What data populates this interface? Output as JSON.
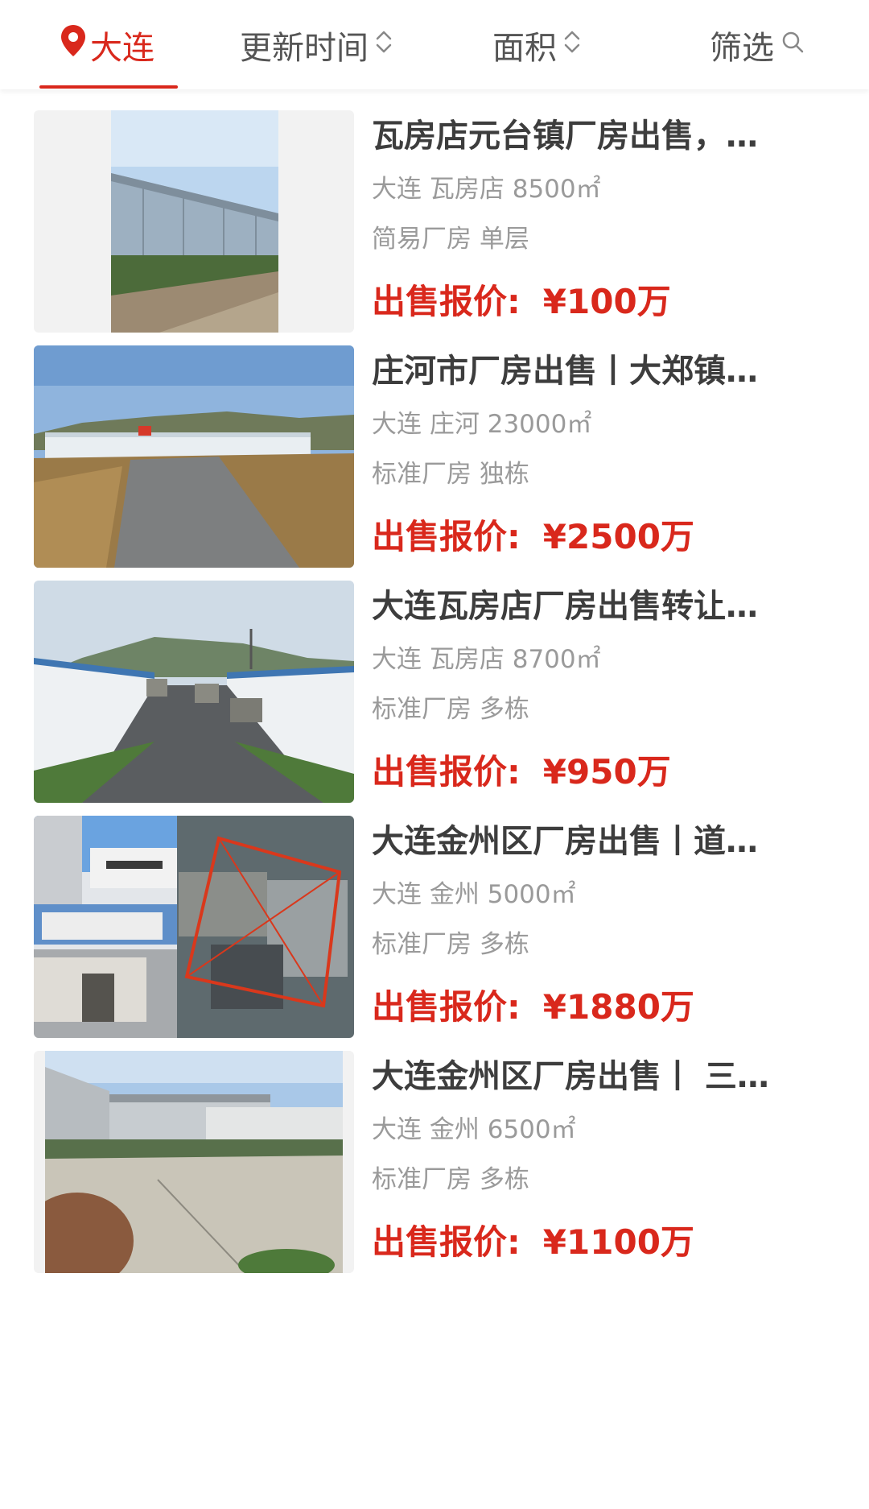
{
  "filter_bar": {
    "location": "大连",
    "sort_update_time": "更新时间",
    "sort_area": "面积",
    "filter": "筛选"
  },
  "colors": {
    "accent": "#d9281c",
    "title": "#3d3d3d",
    "meta": "#9a9a9a",
    "tab_text": "#555555"
  },
  "listings": [
    {
      "title": "瓦房店元台镇厂房出售，…",
      "city": "大连",
      "district": "瓦房店",
      "area": "8500㎡",
      "type": "简易厂房",
      "building": "单层",
      "price_label": "出售报价:",
      "price": "¥100万"
    },
    {
      "title": "庄河市厂房出售丨大郑镇…",
      "city": "大连",
      "district": "庄河",
      "area": "23000㎡",
      "type": "标准厂房",
      "building": "独栋",
      "price_label": "出售报价:",
      "price": "¥2500万"
    },
    {
      "title": "大连瓦房店厂房出售转让…",
      "city": "大连",
      "district": "瓦房店",
      "area": "8700㎡",
      "type": "标准厂房",
      "building": "多栋",
      "price_label": "出售报价:",
      "price": "¥950万"
    },
    {
      "title": "大连金州区厂房出售丨道…",
      "city": "大连",
      "district": "金州",
      "area": "5000㎡",
      "type": "标准厂房",
      "building": "多栋",
      "price_label": "出售报价:",
      "price": "¥1880万"
    },
    {
      "title": "大连金州区厂房出售丨 三…",
      "city": "大连",
      "district": "金州",
      "area": "6500㎡",
      "type": "标准厂房",
      "building": "多栋",
      "price_label": "出售报价:",
      "price": "¥1100万"
    }
  ]
}
